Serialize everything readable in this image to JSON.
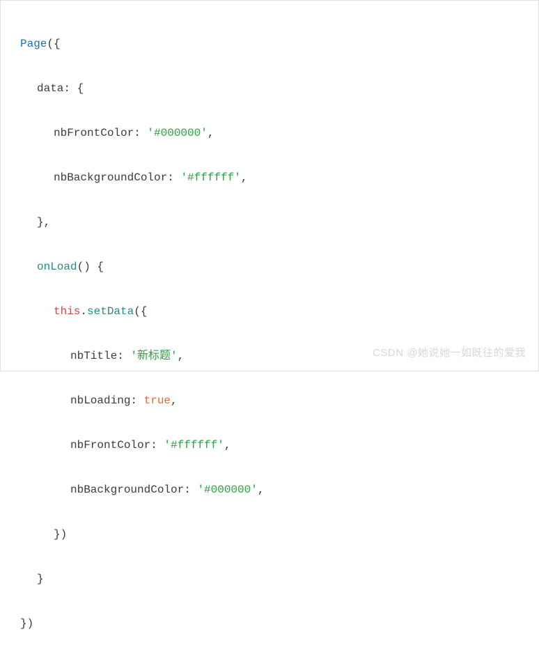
{
  "code": {
    "fn_page": "Page",
    "key_data": "data",
    "k_nbFrontColor": "nbFrontColor",
    "v_dataFront": "'#000000'",
    "k_nbBackgroundColor": "nbBackgroundColor",
    "v_dataBg": "'#ffffff'",
    "fn_onLoad": "onLoad",
    "kw_this": "this",
    "fn_setData": "setData",
    "k_nbTitle": "nbTitle",
    "v_title": "'新标题'",
    "k_nbLoading": "nbLoading",
    "v_loading": "true",
    "v_loadFront": "'#ffffff'",
    "v_loadBg": "'#000000'"
  },
  "watermark": "CSDN @她说她一如既往的爱我"
}
